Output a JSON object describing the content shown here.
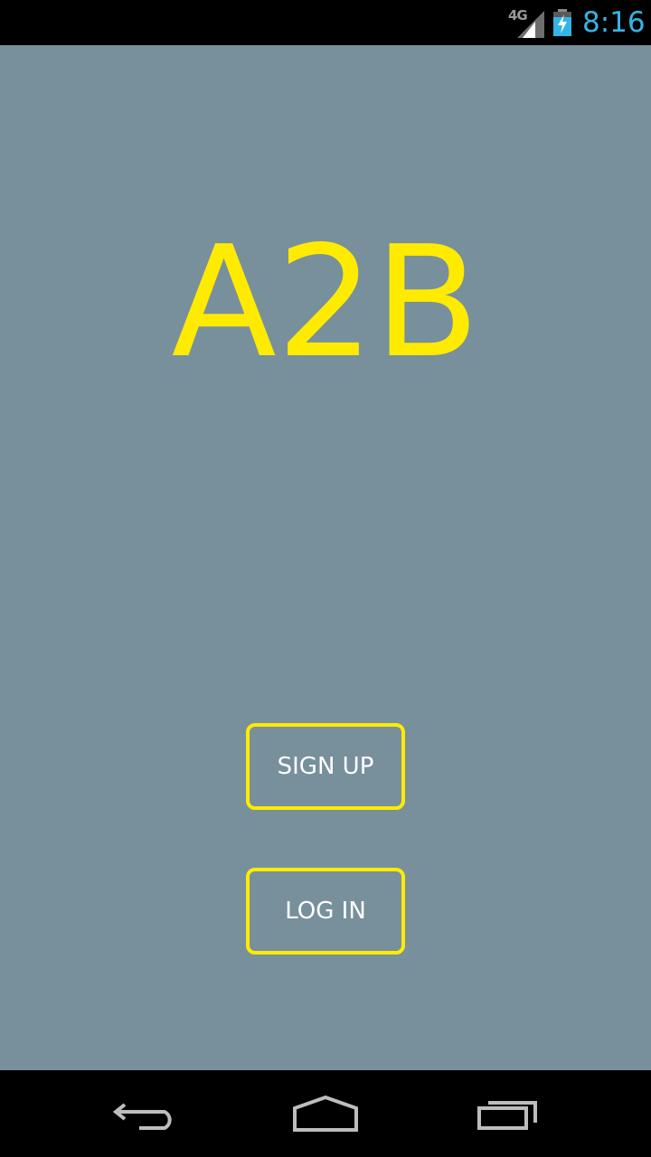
{
  "status_bar": {
    "network_label": "4G",
    "network_icon": "signal-icon",
    "battery_icon": "battery-charging-icon",
    "time": "8:16",
    "time_color": "#33b5e5"
  },
  "main": {
    "background_color": "#78909c",
    "logo_text": "A2B",
    "accent_color": "#ffeb00",
    "signup_label": "SIGN UP",
    "login_label": "LOG IN"
  },
  "nav_bar": {
    "back_icon": "back-icon",
    "home_icon": "home-icon",
    "recents_icon": "recents-icon"
  }
}
